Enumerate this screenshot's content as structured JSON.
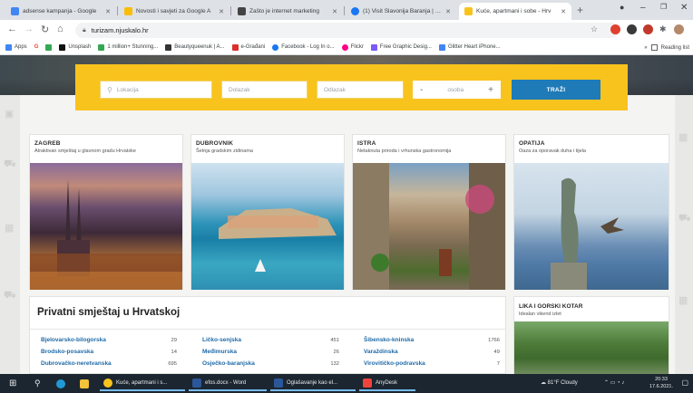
{
  "browser": {
    "tabs": [
      {
        "title": "adsense kampanja - Google",
        "favicon_color": "#4285f4"
      },
      {
        "title": "Novosti i savjeti za Google A",
        "favicon_color": "#fbbc05"
      },
      {
        "title": "Zašto je internet marketing",
        "favicon_color": "#444444"
      },
      {
        "title": "(1) Visit Slavonija Baranja | Fa",
        "favicon_color": "#1877f2"
      },
      {
        "title": "Kuće, apartmani i sobe - Hrv",
        "favicon_color": "#f9c31e",
        "active": true
      }
    ],
    "new_tab": "+",
    "url": "turizam.njuskalo.hr",
    "bookmarks": [
      {
        "label": "Apps",
        "color": "#4285f4"
      },
      {
        "label": "G",
        "color": "#ea4335"
      },
      {
        "label": "",
        "color": "#34a853"
      },
      {
        "label": "Unsplash",
        "color": "#111111"
      },
      {
        "label": "1 million+ Stunning...",
        "color": "#34a853"
      },
      {
        "label": "Beautyqueenuk | A...",
        "color": "#333333"
      },
      {
        "label": "e-Građani",
        "color": "#d9302c"
      },
      {
        "label": "Facebook - Log In o...",
        "color": "#1877f2"
      },
      {
        "label": "Flickr",
        "color": "#ff0084"
      },
      {
        "label": "Free Graphic Desig...",
        "color": "#7a5af8"
      },
      {
        "label": "Glitter Heart iPhone...",
        "color": "#4285f4"
      }
    ],
    "bookmarks_more": "»",
    "reading_list": "Reading list"
  },
  "search": {
    "location_placeholder": "Lokacija",
    "checkin_placeholder": "Dolazak",
    "checkout_placeholder": "Odlazak",
    "guests_placeholder": "osoba",
    "minus": "-",
    "plus": "+",
    "submit_label": "TRAŽI"
  },
  "regions": [
    {
      "title": "ZAGREB",
      "subtitle": "Atraktivan smještaj u glavnom gradu Hrvatske"
    },
    {
      "title": "DUBROVNIK",
      "subtitle": "Šetnja gradskim zidinama"
    },
    {
      "title": "ISTRA",
      "subtitle": "Netaknuta priroda i vrhunska gastronomija"
    },
    {
      "title": "OPATIJA",
      "subtitle": "Oaza za oporavak duha i tijela"
    }
  ],
  "accommodation": {
    "title": "Privatni smještaj u Hrvatskoj",
    "columns": [
      [
        {
          "name": "Bjelovarsko-bilogorska",
          "count": "29"
        },
        {
          "name": "Brodsko-posavska",
          "count": "14"
        },
        {
          "name": "Dubrovačko-neretvanska",
          "count": "695"
        }
      ],
      [
        {
          "name": "Ličko-senjska",
          "count": "451"
        },
        {
          "name": "Međimurska",
          "count": "26"
        },
        {
          "name": "Osječko-baranjska",
          "count": "132"
        }
      ],
      [
        {
          "name": "Šibensko-kninska",
          "count": "1766"
        },
        {
          "name": "Varaždinska",
          "count": "49"
        },
        {
          "name": "Virovitičko-podravska",
          "count": "7"
        }
      ]
    ]
  },
  "featured": {
    "title": "LIKA I GORSKI KOTAR",
    "subtitle": "Idealan vikend izlet"
  },
  "taskbar": {
    "items": [
      {
        "label": "Kuće, apartmani i s...",
        "color": "#f9c31e"
      },
      {
        "label": "efos.docx - Word",
        "color": "#2b579a"
      },
      {
        "label": "Oglašavanje kao el...",
        "color": "#2b579a"
      },
      {
        "label": "AnyDesk",
        "color": "#ef443b"
      }
    ],
    "weather": "81°F  Cloudy",
    "time": "20:33",
    "date": "17.6.2021."
  }
}
